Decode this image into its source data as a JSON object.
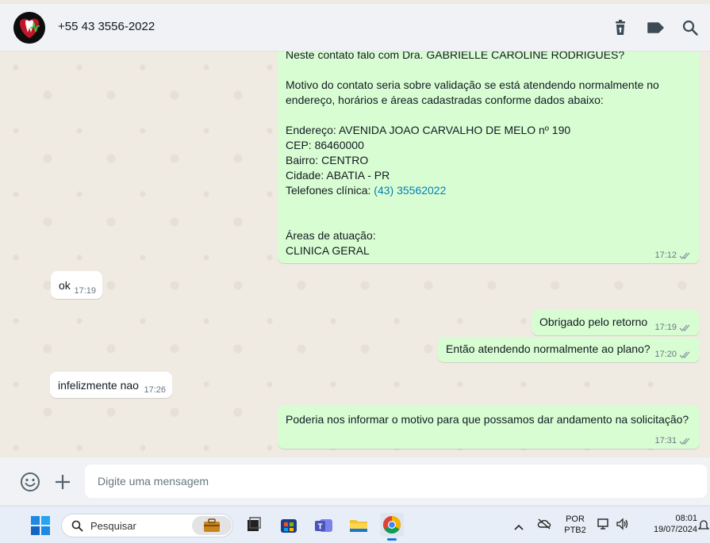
{
  "header": {
    "contact_name": "+55 43 3556-2022"
  },
  "messages": {
    "m1_lines": [
      "Neste contato falo com Dra. GABRIELLE CAROLINE RODRIGUES?",
      "",
      "Motivo do contato seria sobre validação se está atendendo normalmente no",
      "endereço, horários e áreas cadastradas conforme dados abaixo:",
      "",
      "Endereço: AVENIDA JOAO CARVALHO DE MELO nº 190",
      "CEP: 86460000",
      "Bairro: CENTRO",
      "Cidade: ABATIA - PR",
      "Telefones clínica: ",
      "",
      "",
      "Áreas de atuação:",
      "CLINICA GERAL"
    ],
    "m1_phone_link": "(43) 35562022",
    "m1_time": "17:12",
    "m2_text": "ok",
    "m2_time": "17:19",
    "m3_text": "Obrigado pelo retorno",
    "m3_time": "17:19",
    "m4_text": "Então atendendo normalmente ao plano?",
    "m4_time": "17:20",
    "m5_text": "infelizmente nao",
    "m5_time": "17:26",
    "m6_text": "Poderia nos informar o motivo para que possamos dar andamento na solicitação?",
    "m6_time": "17:31"
  },
  "composer": {
    "placeholder": "Digite uma mensagem"
  },
  "taskbar": {
    "search_label": "Pesquisar",
    "lang_top": "POR",
    "lang_bottom": "PTB2",
    "time": "08:01",
    "date": "19/07/2024"
  },
  "colors": {
    "outgoing_bubble": "#d9fdd3",
    "incoming_bubble": "#ffffff",
    "read_tick": "#8696a0",
    "link": "#027eb5"
  }
}
